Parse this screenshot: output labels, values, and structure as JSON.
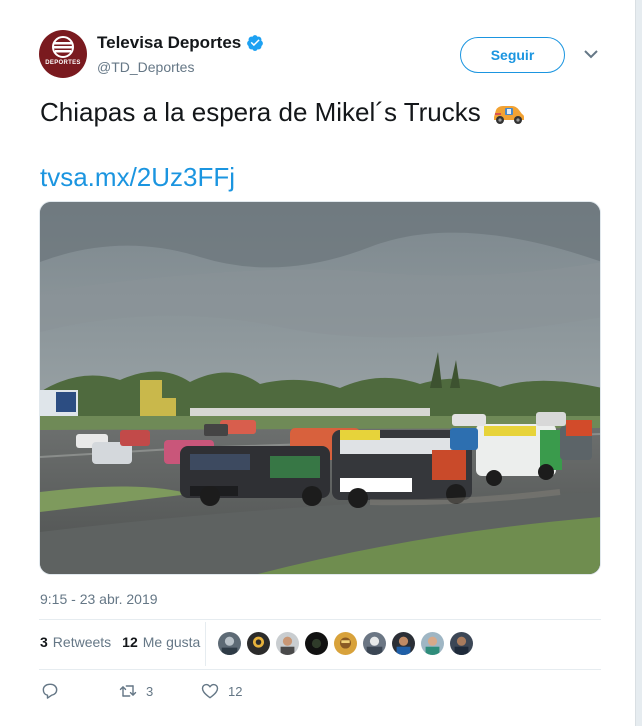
{
  "account": {
    "display_name": "Televisa Deportes",
    "handle": "@TD_Deportes",
    "avatar_text": "DEPORTES",
    "verified": true
  },
  "header": {
    "follow_label": "Seguir",
    "menu_icon": "chevron-down-icon"
  },
  "tweet": {
    "text": "Chiapas a la espera de Mikel´s Trucks",
    "emoji": "racing-car-emoji",
    "link": "tvsa.mx/2Uz3FFj",
    "image_alt": "Racing trucks on a race track under a cloudy sky",
    "timestamp": "9:15 - 23 abr. 2019"
  },
  "stats": {
    "retweets_count": "3",
    "retweets_label": "Retweets",
    "likes_count": "12",
    "likes_label": "Me gusta",
    "liker_avatars": 9
  },
  "actions": {
    "reply_icon": "reply-icon",
    "retweet_icon": "retweet-icon",
    "retweet_count": "3",
    "like_icon": "heart-icon",
    "like_count": "12"
  },
  "colors": {
    "accent": "#1b95e0",
    "text": "#14171a",
    "muted": "#657786",
    "avatar_bg": "#7a1a1f"
  }
}
